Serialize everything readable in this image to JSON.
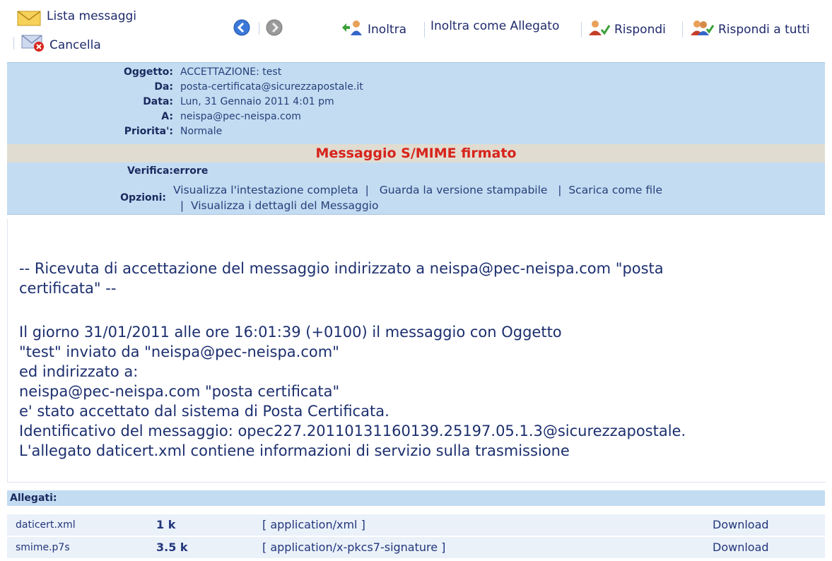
{
  "toolbar": {
    "message_list_label": "Lista messaggi",
    "delete_label": "Cancella",
    "forward_label": "Inoltra",
    "forward_attachment_label": "Inoltra come Allegato",
    "reply_label": "Rispondi",
    "reply_all_label": "Rispondi a tutti"
  },
  "header": {
    "subject_label": "Oggetto:",
    "subject_value": "ACCETTAZIONE: test",
    "from_label": "Da:",
    "from_value": "posta-certificata@sicurezzapostale.it",
    "date_label": "Data:",
    "date_value": "Lun, 31 Gennaio 2011 4:01 pm",
    "to_label": "A:",
    "to_value": "neispa@pec-neispa.com",
    "priority_label": "Priorita':",
    "priority_value": "Normale"
  },
  "smime": {
    "banner": "Messaggio S/MIME firmato",
    "verify_label": "Verifica:",
    "verify_value": "errore",
    "options_label": "Opzioni:",
    "option_full_header": "Visualizza l'intestazione completa",
    "option_printable": "Guarda la versione stampabile",
    "option_download": "Scarica come file",
    "option_details": "Visualizza i dettagli del Messaggio"
  },
  "body": {
    "lines": [
      "-- Ricevuta di accettazione del messaggio indirizzato a neispa@pec-neispa.com \"posta",
      "certificata\" --",
      "",
      "Il giorno 31/01/2011 alle ore 16:01:39 (+0100) il messaggio con Oggetto",
      "\"test\" inviato da \"neispa@pec-neispa.com\"",
      "ed indirizzato a:",
      "neispa@pec-neispa.com \"posta certificata\"",
      "e' stato accettato dal sistema di Posta Certificata.",
      "Identificativo del messaggio: opec227.20110131160139.25197.05.1.3@sicurezzapostale.",
      "L'allegato daticert.xml contiene informazioni di servizio sulla trasmissione"
    ]
  },
  "attachments": {
    "header": "Allegati:",
    "items": [
      {
        "name": "daticert.xml",
        "size": "1 k",
        "type": "[ application/xml ]",
        "action": "Download"
      },
      {
        "name": "smime.p7s",
        "size": "3.5 k",
        "type": "[ application/x-pkcs7-signature ]",
        "action": "Download"
      }
    ]
  },
  "icons": {
    "message_list": "envelope-icon",
    "delete": "envelope-delete-icon",
    "back": "back-arrow-icon",
    "forward_nav": "forward-arrow-icon",
    "forward": "forward-users-icon",
    "reply": "reply-user-icon",
    "reply_all": "reply-all-users-icon"
  },
  "colors": {
    "header_bg": "#c3dcf2",
    "banner_bg": "#e0dcd1",
    "banner_text": "#d7231b",
    "text": "#1f2a6b"
  }
}
